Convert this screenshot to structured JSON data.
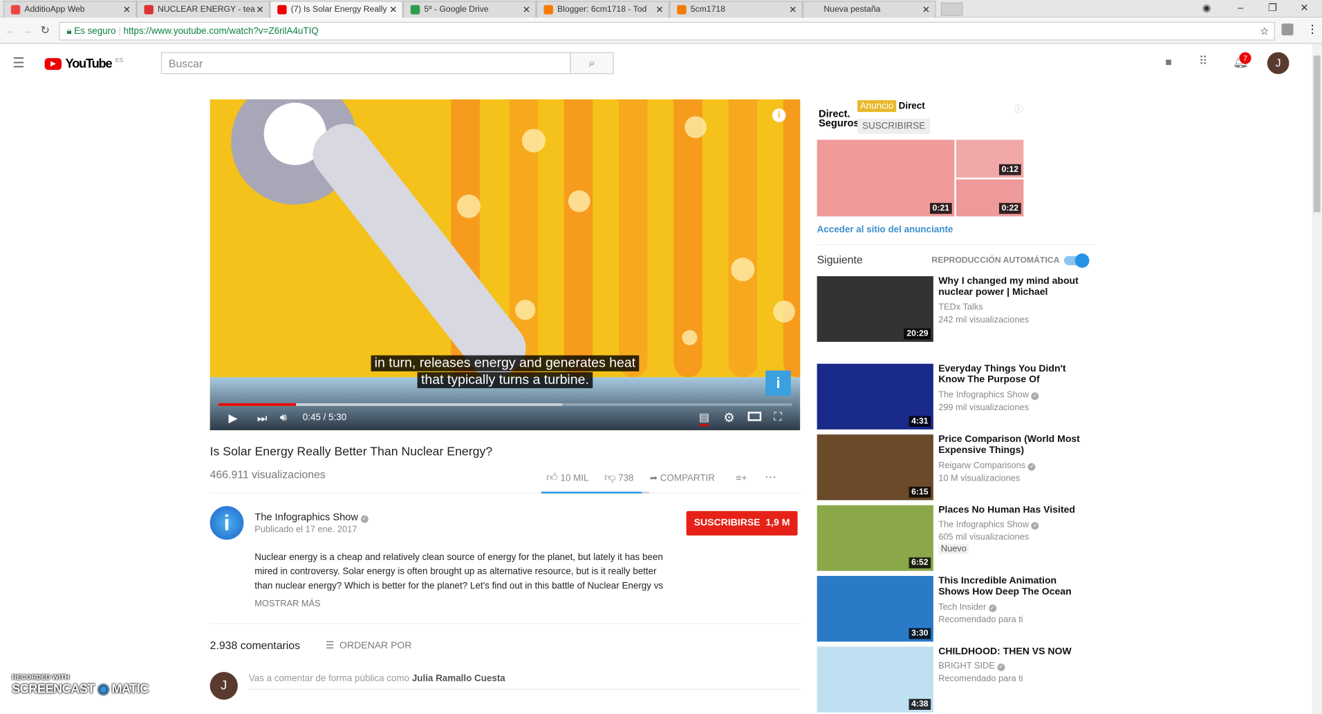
{
  "browser": {
    "tabs": [
      {
        "label": "AdditioApp Web",
        "color": "#e44"
      },
      {
        "label": "NUCLEAR ENERGY - tea",
        "color": "#d33"
      },
      {
        "label": "(7) Is Solar Energy Really",
        "color": "#e00"
      },
      {
        "label": "5º - Google Drive",
        "color": "#2a9d4b"
      },
      {
        "label": "Blogger: 6cm1718 - Tod",
        "color": "#f57c00"
      },
      {
        "label": "5cm1718",
        "color": "#f57c00"
      },
      {
        "label": "Nueva pestaña",
        "color": ""
      }
    ],
    "secure_label": "Es seguro",
    "url": "https://www.youtube.com/watch?v=Z6rilA4uTIQ"
  },
  "header": {
    "logo": "YouTube",
    "region": "ES",
    "search_placeholder": "Buscar",
    "notifications": "7",
    "avatar": "J"
  },
  "player": {
    "caption_line1": "in turn, releases energy and generates heat",
    "caption_line2": "that typically turns a turbine.",
    "time": "0:45 / 5:30",
    "progress": 0.136,
    "buffered": 0.6
  },
  "video": {
    "title": "Is Solar Energy Really Better Than Nuclear Energy?",
    "views": "466.911 visualizaciones",
    "likes": "10 MIL",
    "dislikes": "738",
    "share": "COMPARTIR",
    "like_ratio": 0.93
  },
  "channel": {
    "name": "The Infographics Show",
    "published": "Publicado el 17 ene. 2017",
    "subscribe": "SUSCRIBIRSE",
    "subscribers": "1,9 M",
    "description_1": "Nuclear energy is a cheap and relatively clean source of energy for the planet, but lately it has been",
    "description_2": "mired in controversy. Solar energy is often brought up as alternative resource, but is it really better",
    "description_3": "than nuclear energy? Which is better for the planet? Let's find out in this battle of Nuclear Energy vs",
    "show_more": "MOSTRAR MÁS"
  },
  "comments": {
    "count": "2.938 comentarios",
    "sort": "ORDENAR POR",
    "prompt": "Vas a comentar de forma pública como ",
    "user": "Julia Ramallo Cuesta",
    "avatar": "J"
  },
  "ad": {
    "badge": "Anuncio",
    "name": "Direct",
    "logo": "Direct. Seguros",
    "subscribe": "SUSCRIBIRSE",
    "durations": [
      "0:21",
      "0:12",
      "0:22"
    ],
    "link": "Acceder al sitio del anunciante"
  },
  "upnext": {
    "label": "Siguiente",
    "autoplay": "REPRODUCCIÓN AUTOMÁTICA",
    "autoplay_on": true
  },
  "recommendations": [
    {
      "title": "Why I changed my mind about nuclear power | Michael",
      "channel": "TEDx Talks",
      "meta": "242 mil visualizaciones",
      "duration": "20:29",
      "verified": false,
      "color": "#333"
    },
    {
      "title": "Everyday Things You Didn't Know The Purpose Of",
      "channel": "The Infographics Show",
      "meta": "299 mil visualizaciones",
      "duration": "4:31",
      "verified": true,
      "color": "#1a2a8a"
    },
    {
      "title": "Price Comparison (World Most Expensive Things)",
      "channel": "Reigarw Comparisons",
      "meta": "10 M visualizaciones",
      "duration": "6:15",
      "verified": true,
      "color": "#6b4a2a"
    },
    {
      "title": "Places No Human Has Visited",
      "channel": "The Infographics Show",
      "meta": "605 mil visualizaciones",
      "duration": "6:52",
      "verified": true,
      "color": "#8aa84a",
      "badge": "Nuevo"
    },
    {
      "title": "This Incredible Animation Shows How Deep The Ocean",
      "channel": "Tech Insider",
      "meta": "Recomendado para ti",
      "duration": "3:30",
      "verified": true,
      "color": "#2a7ac8"
    },
    {
      "title": "CHILDHOOD: THEN VS NOW",
      "channel": "BRIGHT SIDE",
      "meta": "Recomendado para ti",
      "duration": "4:38",
      "verified": true,
      "color": "#bfe0f0"
    }
  ],
  "watermark": {
    "line1": "RECORDED WITH",
    "line2": "SCREENCAST",
    "line3": "MATIC"
  }
}
